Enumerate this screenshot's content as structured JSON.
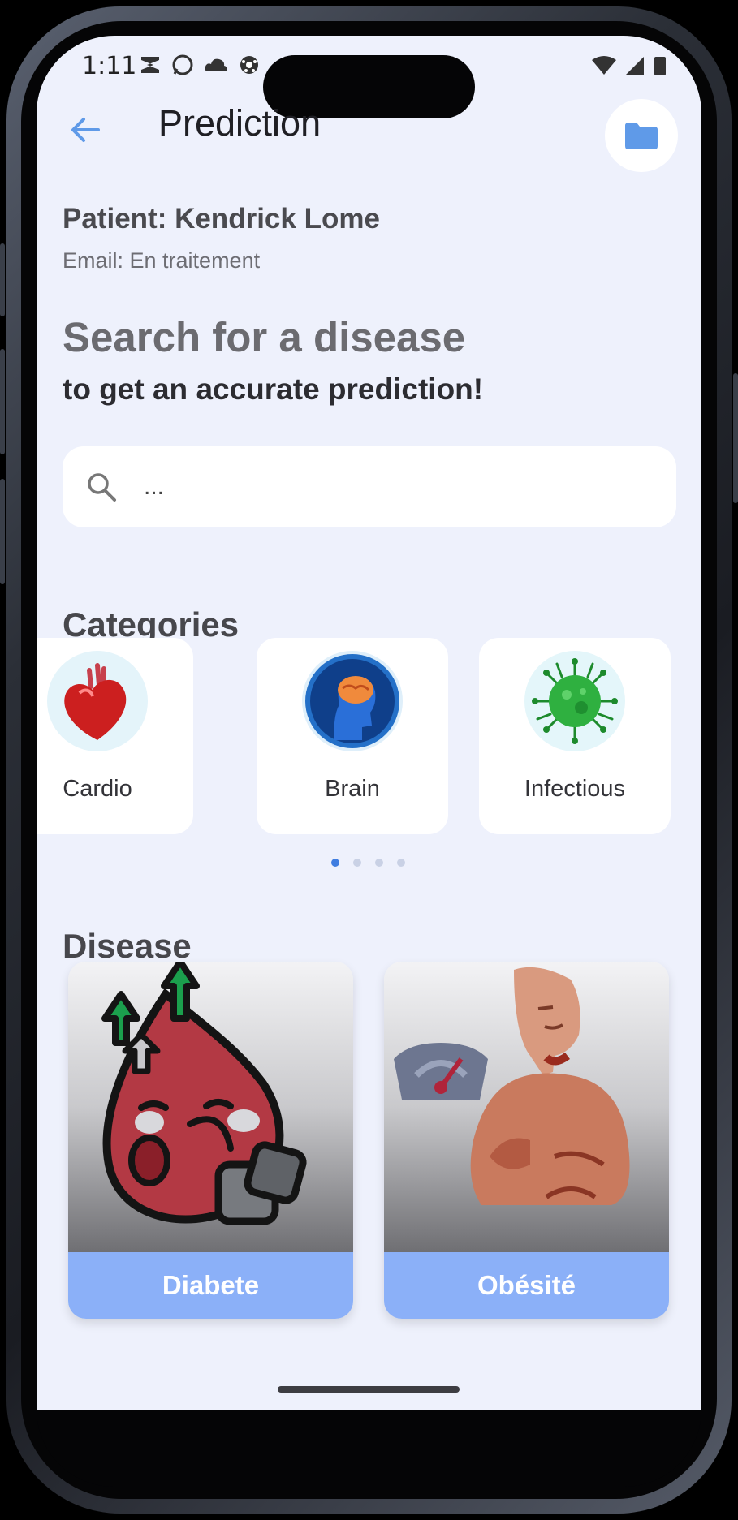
{
  "status_bar": {
    "time": "1:11"
  },
  "header": {
    "title": "Prediction",
    "back_icon": "arrow-left-icon",
    "folder_icon": "folder-icon"
  },
  "patient": {
    "name": "Patient: Kendrick Lome",
    "email": "Email: En traitement"
  },
  "hero": {
    "title": "Search for a disease",
    "subtitle": "to get an accurate prediction!"
  },
  "search": {
    "placeholder": "..."
  },
  "categories": {
    "title": "Categories",
    "items": [
      {
        "label": "Cardio",
        "icon": "heart-icon"
      },
      {
        "label": "Brain",
        "icon": "brain-icon"
      },
      {
        "label": "Infectious",
        "icon": "virus-icon"
      }
    ],
    "pages": 4,
    "active_page": 1
  },
  "disease": {
    "title": "Disease",
    "items": [
      {
        "label": "Diabete",
        "icon": "blood-drop-icon"
      },
      {
        "label": "Obésité",
        "icon": "obesity-icon"
      }
    ]
  },
  "colors": {
    "background": "#eef1fc",
    "accent": "#8bb0f8",
    "icon_blue": "#5f9ae8"
  }
}
